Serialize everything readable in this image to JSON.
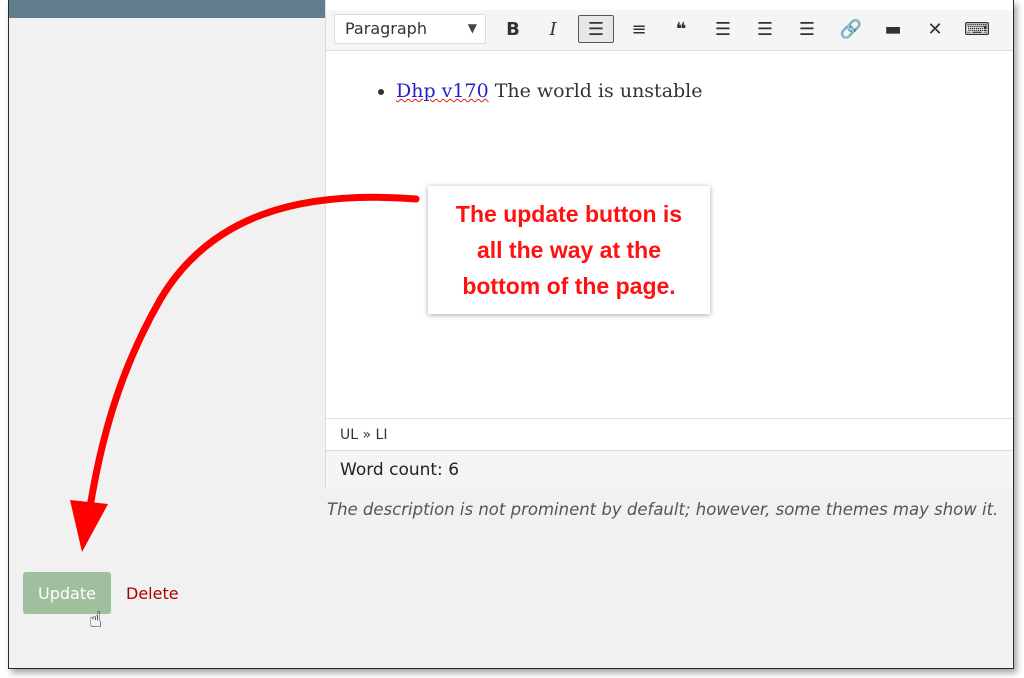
{
  "editor": {
    "format_select": "Paragraph",
    "toolbar": [
      {
        "name": "bold-button",
        "glyph": "B"
      },
      {
        "name": "italic-button",
        "glyph": "I"
      },
      {
        "name": "bulleted-list-button",
        "glyph": "☰"
      },
      {
        "name": "numbered-list-button",
        "glyph": "≡"
      },
      {
        "name": "blockquote-button",
        "glyph": "❝"
      },
      {
        "name": "align-left-button",
        "glyph": "☰"
      },
      {
        "name": "align-center-button",
        "glyph": "☰"
      },
      {
        "name": "align-right-button",
        "glyph": "☰"
      },
      {
        "name": "insert-link-button",
        "glyph": "🔗"
      },
      {
        "name": "read-more-button",
        "glyph": "▬"
      },
      {
        "name": "fullscreen-button",
        "glyph": "✕"
      },
      {
        "name": "toolbar-toggle-button",
        "glyph": "⌨"
      }
    ],
    "content": {
      "link_text": "Dhp v170",
      "body_text": " The world is unstable"
    },
    "element_path": "UL » LI",
    "word_count": "Word count: 6"
  },
  "description_hint": "The description is not prominent by default; however, some themes may show it.",
  "actions": {
    "update_label": "Update",
    "delete_label": "Delete"
  },
  "callout": {
    "lines": [
      "The update button is",
      "all the way at the",
      "bottom of the page."
    ],
    "color": "#ff1111"
  },
  "colors": {
    "update_button_bg": "#9fbf9f",
    "delete_link": "#aa0000",
    "arrow": "#ff0000"
  }
}
